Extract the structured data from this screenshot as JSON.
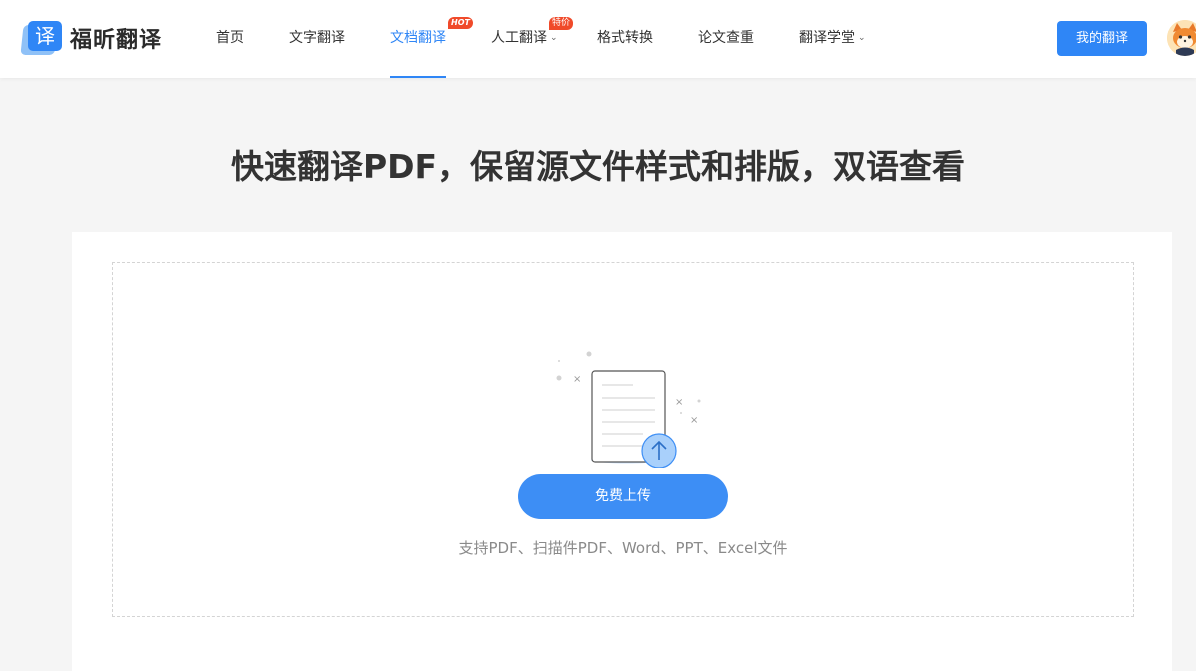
{
  "header": {
    "logo_text": "福昕翻译",
    "logo_glyph": "译",
    "nav": [
      {
        "label": "首页"
      },
      {
        "label": "文字翻译"
      },
      {
        "label": "文档翻译",
        "active": true,
        "badge": "HOT"
      },
      {
        "label": "人工翻译",
        "dropdown": true,
        "badge": "特价"
      },
      {
        "label": "格式转换"
      },
      {
        "label": "论文查重"
      },
      {
        "label": "翻译学堂",
        "dropdown": true
      }
    ],
    "my_translations": "我的翻译",
    "avatar_icon": "fox-avatar-icon"
  },
  "main": {
    "headline": "快速翻译PDF，保留源文件样式和排版，双语查看",
    "upload": {
      "button_label": "免费上传",
      "hint": "支持PDF、扫描件PDF、Word、PPT、Excel文件",
      "illustration_icon": "document-upload-icon"
    }
  },
  "colors": {
    "accent": "#2f86f6",
    "badge": "#f04a2a",
    "background": "#f5f5f5"
  }
}
